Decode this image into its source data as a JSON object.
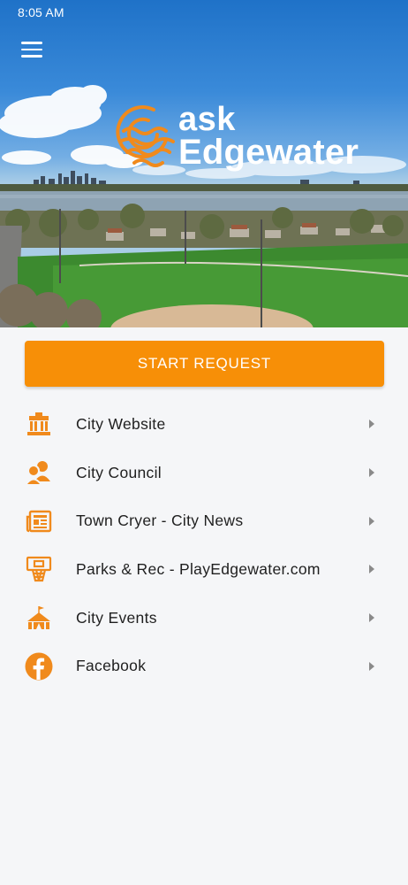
{
  "status_bar": {
    "time": "8:05 AM"
  },
  "header": {
    "menu_icon": "hamburger-icon",
    "logo": {
      "line1": "ask",
      "line2": "Edgewater"
    }
  },
  "colors": {
    "accent": "#f78f07",
    "text": "#1f1f1f",
    "background": "#f5f6f8",
    "chevron": "#8a8a8a"
  },
  "start_request": {
    "label": "START REQUEST"
  },
  "menu": {
    "items": [
      {
        "label": "City Website",
        "icon": "city-hall-icon"
      },
      {
        "label": "City Council",
        "icon": "people-icon"
      },
      {
        "label": "Town Cryer - City News",
        "icon": "newspaper-icon"
      },
      {
        "label": "Parks & Rec - PlayEdgewater.com",
        "icon": "basketball-hoop-icon"
      },
      {
        "label": "City Events",
        "icon": "circus-tent-icon"
      },
      {
        "label": "Facebook",
        "icon": "facebook-icon"
      }
    ]
  }
}
